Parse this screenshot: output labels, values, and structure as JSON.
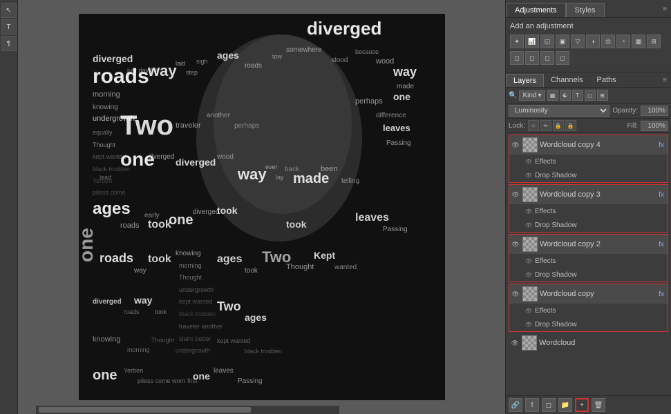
{
  "toolbar": {
    "tools": [
      "M",
      "T",
      "¶"
    ]
  },
  "adjustments": {
    "tab_active": "Adjustments",
    "tab_styles": "Styles",
    "title": "Add an adjustment",
    "icons": [
      "☀",
      "📊",
      "◱",
      "▣",
      "▽",
      "☯",
      "⚖",
      "◑",
      "◔",
      "▦",
      "◻",
      "◻",
      "◻",
      "◻"
    ]
  },
  "layers": {
    "tab_layers": "Layers",
    "tab_channels": "Channels",
    "tab_paths": "Paths",
    "kind_label": "Kind",
    "blend_mode": "Luminosity",
    "opacity_label": "Opacity:",
    "opacity_value": "100%",
    "lock_label": "Lock:",
    "fill_label": "Fill:",
    "fill_value": "100%",
    "items": [
      {
        "name": "Wordcloud copy 4",
        "has_fx": true,
        "effects_label": "Effects",
        "drop_shadow_label": "Drop Shadow",
        "visible": true
      },
      {
        "name": "Wordcloud copy 3",
        "has_fx": true,
        "effects_label": "Effects",
        "drop_shadow_label": "Drop Shadow",
        "visible": true
      },
      {
        "name": "Wordcloud copy 2",
        "has_fx": true,
        "effects_label": "Effects",
        "drop_shadow_label": "Drop Shadow",
        "visible": true
      },
      {
        "name": "Wordcloud copy",
        "has_fx": true,
        "effects_label": "Effects",
        "drop_shadow_label": "Drop Shadow",
        "visible": true
      },
      {
        "name": "Wordcloud",
        "has_fx": false,
        "visible": true,
        "is_bottom": true
      }
    ],
    "bottom_buttons": [
      "🔗",
      "🌀",
      "🎨",
      "📁",
      "🗑"
    ]
  }
}
